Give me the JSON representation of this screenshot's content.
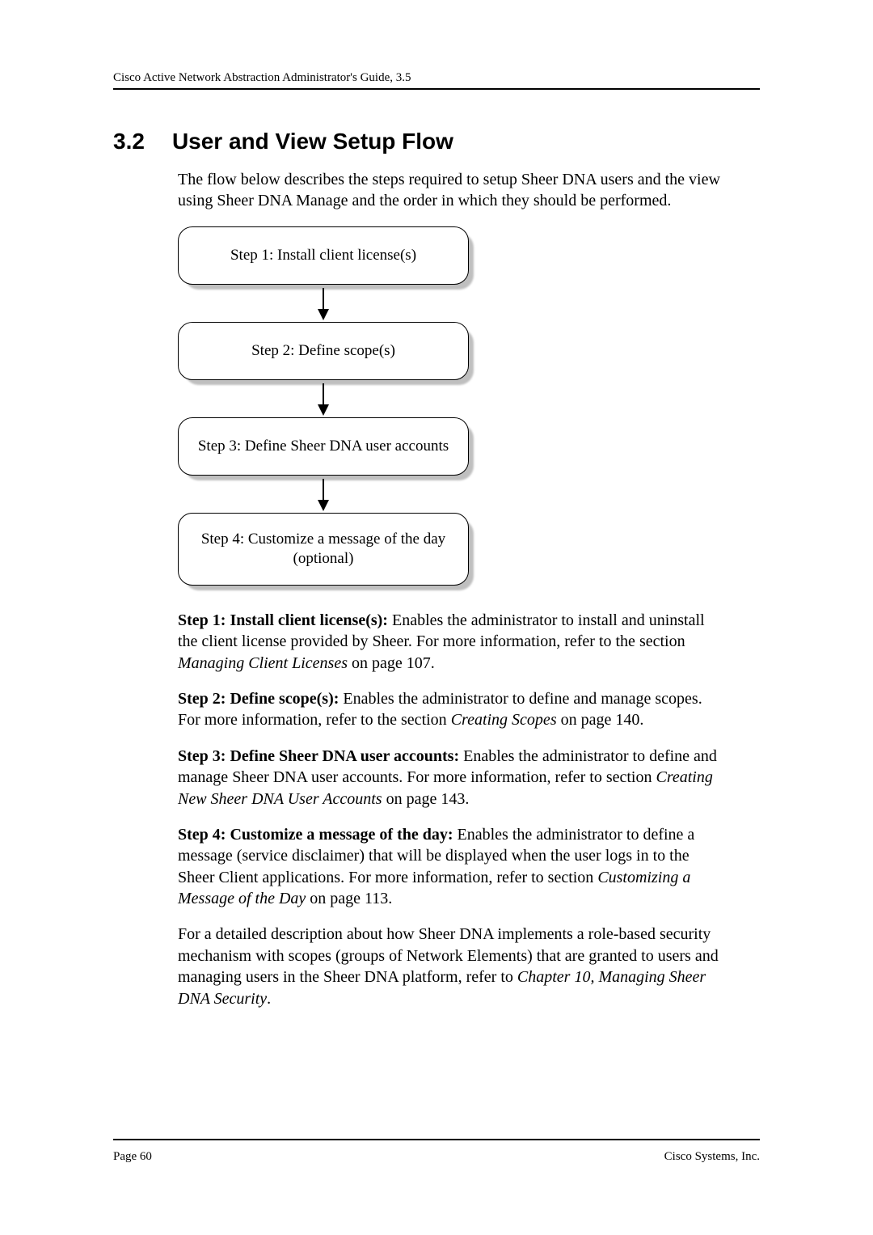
{
  "header": {
    "running": "Cisco Active Network Abstraction Administrator's Guide, 3.5"
  },
  "section": {
    "number": "3.2",
    "title": "User and View Setup Flow"
  },
  "intro": "The flow below describes the steps required to setup Sheer DNA users and the view using Sheer DNA Manage and the order in which they should be performed.",
  "flow": {
    "step1": "Step 1: Install client license(s)",
    "step2": "Step 2: Define scope(s)",
    "step3": "Step 3: Define Sheer DNA user accounts",
    "step4": "Step 4: Customize a message of the day (optional)"
  },
  "steps": {
    "s1": {
      "label": "Step 1: Install client license(s):",
      "text_a": " Enables the administrator to install and uninstall the client license provided by Sheer. For more information, refer to the section ",
      "ref": "Managing Client Licenses",
      "text_b": " on page 107."
    },
    "s2": {
      "label": "Step 2: Define scope(s):",
      "text_a": " Enables the administrator to define and manage scopes. For more information, refer to the section ",
      "ref": "Creating Scopes",
      "text_b": " on page 140."
    },
    "s3": {
      "label": "Step 3: Define Sheer DNA user accounts:",
      "text_a": " Enables the administrator to define and manage Sheer DNA user accounts. For more information, refer to section ",
      "ref": "Creating New Sheer DNA User Accounts",
      "text_b": " on page 143."
    },
    "s4": {
      "label": "Step 4: Customize a message of the day:",
      "text_a": " Enables the administrator to define a message (service disclaimer) that will be displayed when the user logs in to the Sheer Client applications. For more information, refer to section ",
      "ref": "Customizing a Message of the Day",
      "text_b": " on page 113."
    }
  },
  "closing": {
    "text_a": "For a detailed description about how Sheer DNA implements a role-based security mechanism with scopes (groups of Network Elements) that are granted to users and managing users in the Sheer DNA platform, refer to ",
    "ref": "Chapter 10, Managing Sheer DNA Security",
    "text_b": "."
  },
  "footer": {
    "left": "Page 60",
    "right": "Cisco Systems, Inc."
  }
}
